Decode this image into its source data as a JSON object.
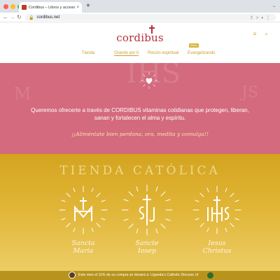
{
  "browser": {
    "tab_title": "Cordibus – Libros y accesorios",
    "tab_close": "×",
    "new_tab": "+",
    "tabs_menu": "⌄",
    "url": "cordibus.net",
    "back": "←",
    "forward": "→",
    "reload": "↻",
    "lock": "🔒",
    "omni_icons": "⇪☆◐⋮"
  },
  "header": {
    "logo": "cordibus",
    "icons": "≡ ⌕",
    "menu": [
      "Tienda",
      "Orando por ti",
      "Rincón espiritual",
      "Evangelizando"
    ],
    "badge": "Nuevo"
  },
  "hero": {
    "text": "Queremos ofrecerte a través de CORDIBUS vitaminas cotidianas que protegen, liberan, sanan y fortalecen el alma y espíritu.",
    "tagline": "¡¡Aliméntate bien perdona, ora, medita y comulga!!",
    "watermarks": [
      "M",
      "IHS",
      "JS"
    ]
  },
  "store": {
    "title": "TIENDA CATÓLICA",
    "emblems": [
      {
        "name_line1": "Sancta",
        "name_line2": "Maria",
        "monogram": "M"
      },
      {
        "name_line1": "Sancte",
        "name_line2": "Iosep",
        "monogram": "SJ"
      },
      {
        "name_line1": "Iesus",
        "name_line2": "Christus",
        "monogram": "IHS"
      }
    ],
    "promo": "Este mes el 11% de su compra se donará a: Uganda's Catholic Diocese of"
  },
  "colors": {
    "brand": "#b3303a",
    "gold": "#d4a12e",
    "hero_pink": "#d46a7d",
    "store_gold": "#e1b638"
  }
}
